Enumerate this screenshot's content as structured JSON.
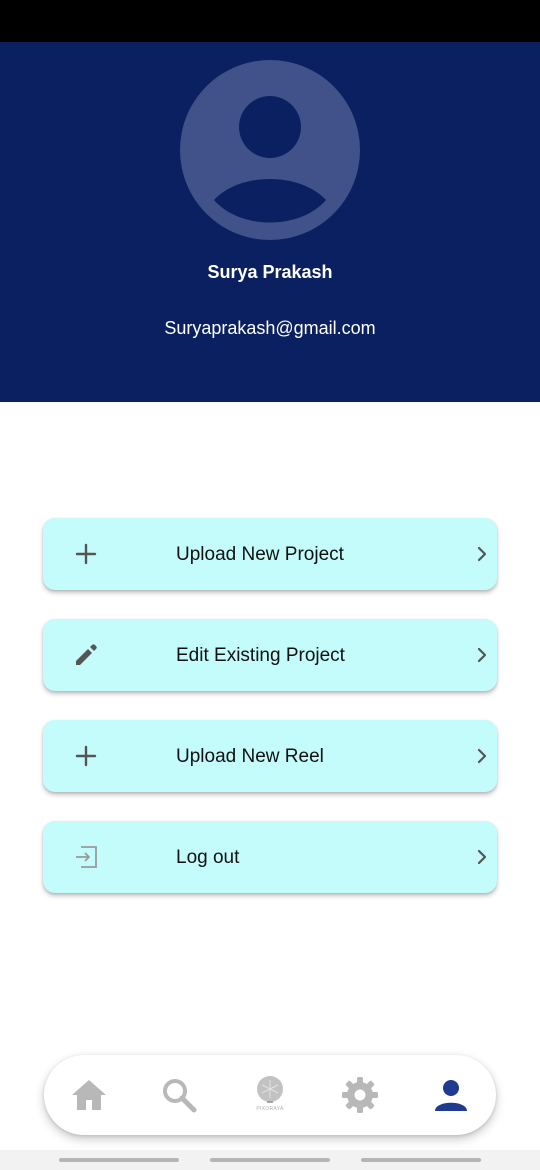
{
  "profile": {
    "name": "Surya Prakash",
    "email": "Suryaprakash@gmail.com",
    "avatar_icon": "person-icon"
  },
  "menu": [
    {
      "label": "Upload New Project",
      "icon": "plus-icon"
    },
    {
      "label": "Edit Existing Project",
      "icon": "pencil-icon"
    },
    {
      "label": "Upload New Reel",
      "icon": "plus-icon"
    },
    {
      "label": "Log out",
      "icon": "logout-icon"
    }
  ],
  "bottom_nav": {
    "items": [
      {
        "name": "home",
        "icon": "home-icon"
      },
      {
        "name": "search",
        "icon": "search-icon"
      },
      {
        "name": "logo",
        "icon": "app-logo-icon",
        "caption": "PIXORAYA"
      },
      {
        "name": "settings",
        "icon": "gear-icon"
      },
      {
        "name": "profile",
        "icon": "person-icon"
      }
    ],
    "active": "profile"
  },
  "colors": {
    "header_bg": "#0b2060",
    "card_bg": "#c4fbfb",
    "active_nav": "#1f3b8f",
    "inactive_nav": "#b8b8b8"
  }
}
